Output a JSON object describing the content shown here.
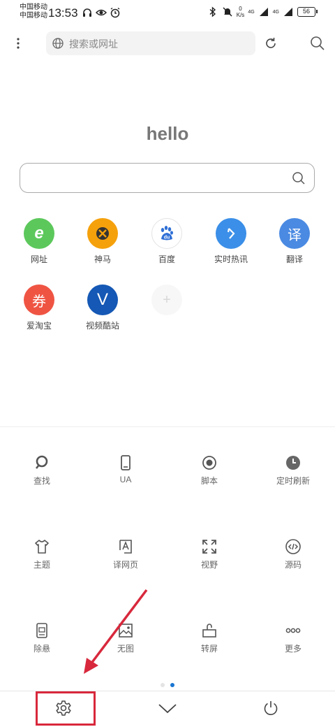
{
  "status_bar": {
    "carrier1": "中国移动",
    "carrier2": "中国移动",
    "time": "13:53",
    "net_speed_value": "0",
    "net_speed_unit": "K/s",
    "sig1": "4G",
    "sig2": "4G",
    "battery": "56"
  },
  "toolbar": {
    "address_placeholder": "搜索或网址"
  },
  "home": {
    "title": "hello",
    "shortcuts": [
      {
        "label": "网址",
        "glyph": "e",
        "color": "#5cc85c"
      },
      {
        "label": "神马",
        "glyph": "",
        "color": "#f5a10c"
      },
      {
        "label": "百度",
        "glyph": "du",
        "color": "#ffffff"
      },
      {
        "label": "实时热讯",
        "glyph": "",
        "color": "#3b8fe8"
      },
      {
        "label": "翻译",
        "glyph": "译",
        "color": "#4a8ae2"
      },
      {
        "label": "爱淘宝",
        "glyph": "券",
        "color": "#ef5443"
      },
      {
        "label": "视频酷站",
        "glyph": "V",
        "color": "#1558b5"
      },
      {
        "label": "",
        "glyph": "+",
        "color": "#f7f7f7"
      }
    ]
  },
  "menu_grid": [
    {
      "label": "查找",
      "icon": "search-icon"
    },
    {
      "label": "UA",
      "icon": "phone-icon"
    },
    {
      "label": "脚本",
      "icon": "record-icon"
    },
    {
      "label": "定时刷新",
      "icon": "clock-icon"
    },
    {
      "label": "主题",
      "icon": "shirt-icon"
    },
    {
      "label": "译网页",
      "icon": "translate-page-icon"
    },
    {
      "label": "视野",
      "icon": "expand-icon"
    },
    {
      "label": "源码",
      "icon": "code-icon"
    },
    {
      "label": "除悬",
      "icon": "remove-float-icon"
    },
    {
      "label": "无图",
      "icon": "no-image-icon"
    },
    {
      "label": "转屏",
      "icon": "rotate-screen-icon"
    },
    {
      "label": "更多",
      "icon": "more-icon"
    }
  ],
  "pager": {
    "count": 2,
    "active": 1
  },
  "bottom_bar": [
    "settings-icon",
    "chevron-down-icon",
    "power-icon"
  ],
  "colors": {
    "highlight": "#d8283c",
    "accent": "#1976d2"
  }
}
